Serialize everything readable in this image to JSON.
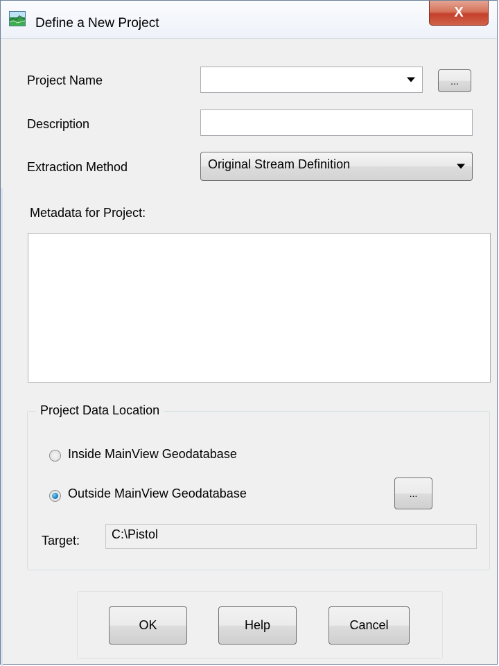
{
  "window": {
    "title": "Define a New Project",
    "close_glyph": "X"
  },
  "form": {
    "project_name": {
      "label": "Project Name",
      "value": "",
      "browse_label": "..."
    },
    "description": {
      "label": "Description",
      "value": ""
    },
    "extraction_method": {
      "label": "Extraction Method",
      "selected": "Original Stream Definition"
    },
    "metadata": {
      "label": "Metadata for Project:",
      "value": ""
    }
  },
  "data_location": {
    "title": "Project Data Location",
    "options": [
      {
        "label": "Inside MainView Geodatabase",
        "checked": false
      },
      {
        "label": "Outside MainView Geodatabase",
        "checked": true
      }
    ],
    "browse_label": "...",
    "target_label": "Target:",
    "target_value": "C:\\Pistol"
  },
  "buttons": {
    "ok": "OK",
    "help": "Help",
    "cancel": "Cancel"
  },
  "icons": {
    "app": "map-landscape-icon",
    "combo_arrow": "dropdown-arrow-icon"
  }
}
